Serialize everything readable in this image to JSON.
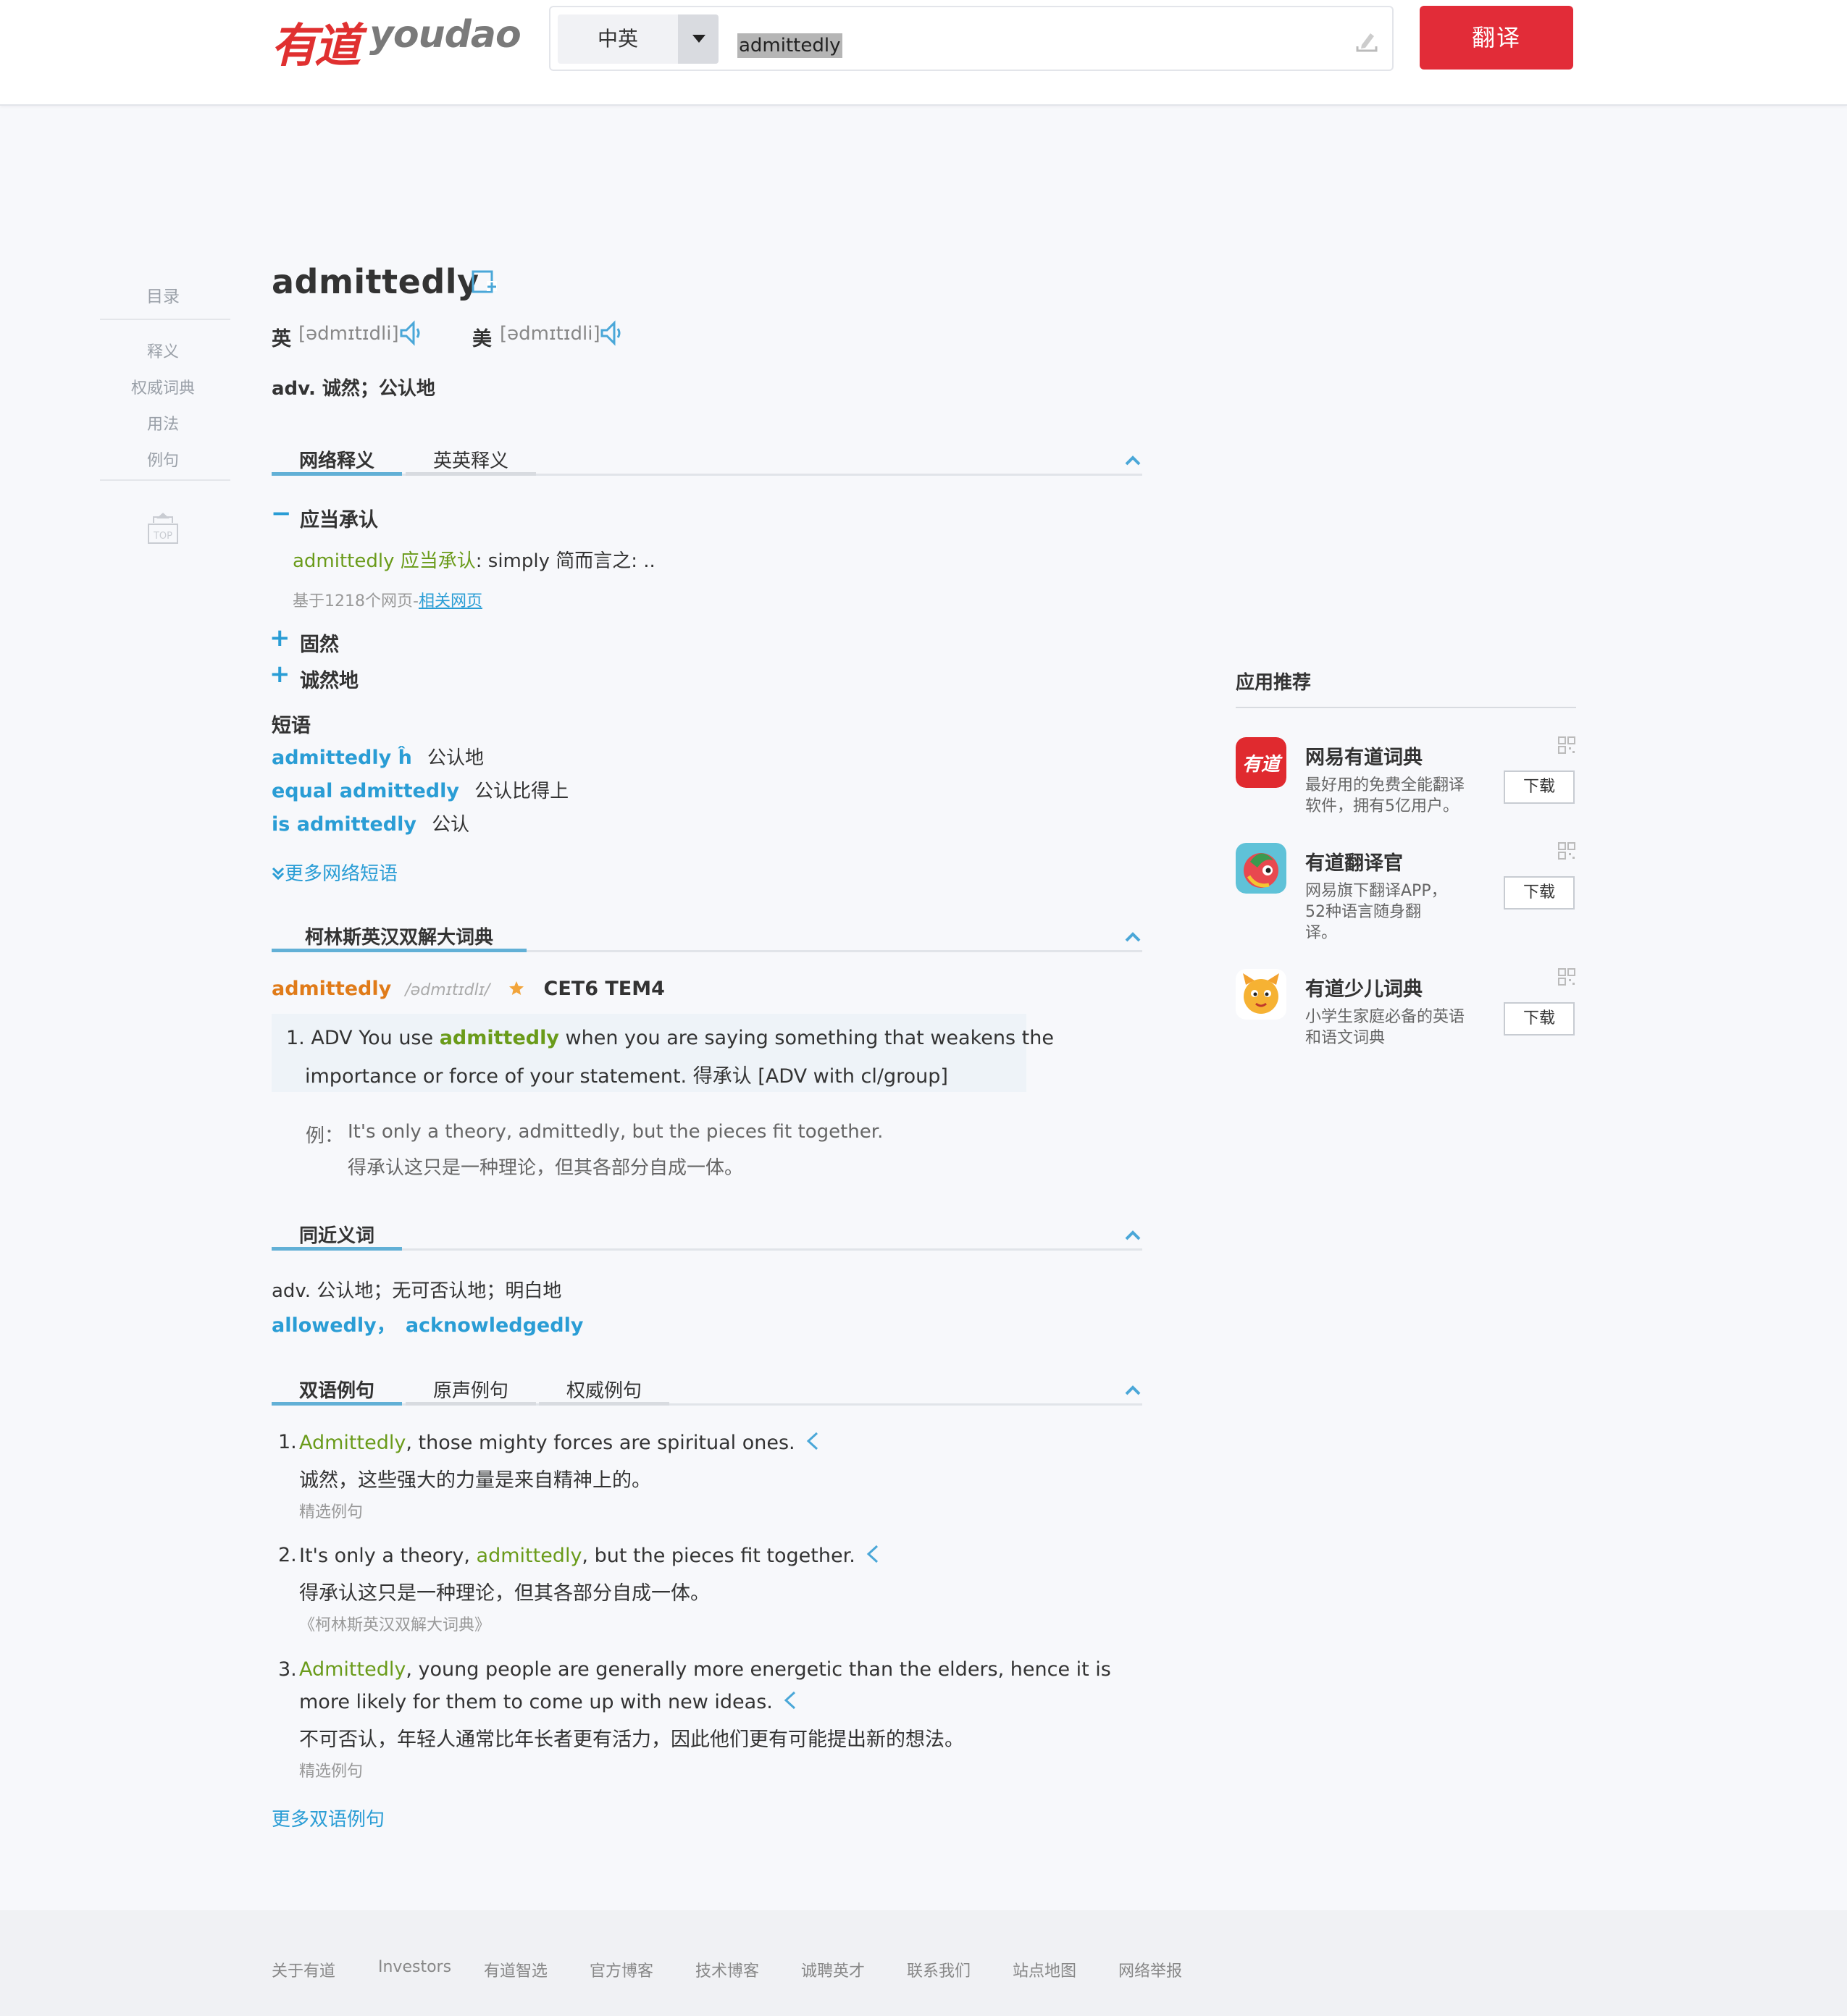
{
  "header": {
    "logo_cn": "有道",
    "logo_en": "youdao",
    "lang_select": "中英",
    "search_value": "admittedly",
    "translate_button": "翻译"
  },
  "toc": {
    "title": "目录",
    "items": [
      "释义",
      "权威词典",
      "用法",
      "例句"
    ],
    "top_label": "TOP"
  },
  "word": {
    "headword": "admittedly",
    "uk_label": "英",
    "uk_phonetic": "[ədmɪtɪdli]",
    "us_label": "美",
    "us_phonetic": "[ədmɪtɪdli]",
    "basic_definition": "adv. 诚然；公认地"
  },
  "web_definitions": {
    "tabs": [
      "网络释义",
      "英英释义"
    ],
    "expanded": {
      "sign": "−",
      "term": "应当承认",
      "example_en": "admittedly 应当承认",
      "example_rest": ": simply 简而言之: ..",
      "source_prefix": "基于1218个网页-",
      "source_link": "相关网页"
    },
    "collapsed": [
      {
        "sign": "+",
        "term": "固然"
      },
      {
        "sign": "+",
        "term": "诚然地"
      }
    ],
    "phrases_title": "短语",
    "phrases": [
      {
        "en": "admittedly ĥ",
        "cn": "公认地"
      },
      {
        "en": "equal admittedly",
        "cn": "公认比得上"
      },
      {
        "en": "is admittedly",
        "cn": "公认"
      }
    ],
    "more_phrases": "更多网络短语",
    "more_icon": "double-chevron-down-icon"
  },
  "collins": {
    "tab": "柯林斯英汉双解大词典",
    "word": "admittedly",
    "phonetic": "/ədmɪtɪdlɪ/",
    "rank_icon": "star-icon",
    "levels": "CET6 TEM4",
    "def_num": "1.",
    "def_pre": "ADV You use ",
    "def_word": "admittedly",
    "def_post": " when you are saying something that weakens the",
    "def_line2": "importance or force of your statement. 得承认 [ADV with cl/group]",
    "example_label": "例：",
    "example_en": "It's only a theory, admittedly, but the pieces fit together.",
    "example_cn": "得承认这只是一种理论，但其各部分自成一体。"
  },
  "synonyms": {
    "tab": "同近义词",
    "pos_line": "adv. 公认地；无可否认地；明白地",
    "words": [
      "allowedly",
      "acknowledgedly"
    ],
    "separator": "，"
  },
  "examples": {
    "tabs": [
      "双语例句",
      "原声例句",
      "权威例句"
    ],
    "items": [
      {
        "num": "1.",
        "pre": "",
        "word": "Admittedly",
        "post": ", those mighty forces are spiritual ones.",
        "line2_en": "",
        "cn": "诚然，这些强大的力量是来自精神上的。",
        "src": "精选例句"
      },
      {
        "num": "2.",
        "pre": "It's only a theory, ",
        "word": "admittedly",
        "post": ", but the pieces fit together.",
        "line2_en": "",
        "cn": "得承认这只是一种理论，但其各部分自成一体。",
        "src": "《柯林斯英汉双解大词典》"
      },
      {
        "num": "3.",
        "pre": "",
        "word": "Admittedly",
        "post": ", young people are generally more energetic than the elders, hence it is",
        "line2_en": "more likely for them to come up with new ideas.",
        "cn": "不可否认，年轻人通常比年长者更有活力，因此他们更有可能提出新的想法。",
        "src": "精选例句"
      }
    ],
    "more": "更多双语例句"
  },
  "apps": {
    "title": "应用推荐",
    "download_label": "下载",
    "items": [
      {
        "name": "网易有道词典",
        "desc": "最好用的免费全能翻译软件，拥有5亿用户。",
        "icon": "youdao-dict-icon"
      },
      {
        "name": "有道翻译官",
        "desc": "网易旗下翻译APP，52种语言随身翻译。",
        "icon": "youdao-translator-icon"
      },
      {
        "name": "有道少儿词典",
        "desc": "小学生家庭必备的英语和语文词典",
        "icon": "youdao-kids-icon"
      }
    ]
  },
  "footer": {
    "links": [
      "关于有道",
      "Investors",
      "有道智选",
      "官方博客",
      "技术博客",
      "诚聘英才",
      "联系我们",
      "站点地图",
      "网络举报"
    ]
  },
  "colors": {
    "brand_red": "#e22c38",
    "link_blue": "#2a9dd5",
    "highlight_green": "#6a9b1a",
    "collins_orange": "#e07b19"
  }
}
